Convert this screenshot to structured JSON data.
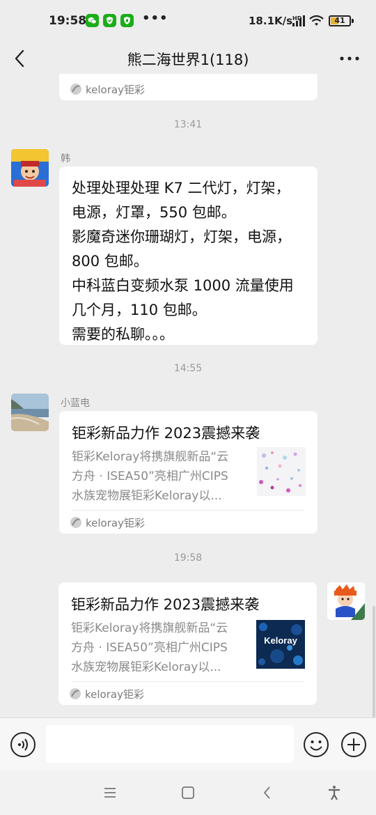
{
  "status_bar": {
    "time": "19:58",
    "more": "•••",
    "speed": "18.1K/s",
    "hd_badge": "HD",
    "battery_level": "41",
    "app_icons": [
      "wechat-icon",
      "shield-icon",
      "shield-icon"
    ]
  },
  "header": {
    "title": "熊二海世界1(118)"
  },
  "top_card": {
    "source": "keloray钜彩"
  },
  "messages": [
    {
      "time": "13:41",
      "sender": "韩",
      "lines": [
        "处理处理处理 K7 二代灯，灯架，",
        "电源，灯罩，550 包邮。",
        "影魔奇迷你珊瑚灯，灯架，电源，",
        "800 包邮。",
        "中科蓝白变频水泵 1000 流量使用",
        "几个月，110 包邮。",
        "需要的私聊。。。"
      ]
    },
    {
      "time": "14:55",
      "sender": "小蓝电",
      "card": {
        "title": "钜彩新品力作 2023震撼来袭",
        "desc": [
          "钜彩Keloray将携旗舰新品“云",
          "方舟 · ISEA50”亮相广州CIPS",
          "水族宠物展钜彩Keloray以..."
        ],
        "source": "keloray钜彩"
      }
    },
    {
      "time": "19:58",
      "sender": "",
      "card": {
        "title": "钜彩新品力作 2023震撼来袭",
        "desc": [
          "钜彩Keloray将携旗舰新品“云",
          "方舟 · ISEA50”亮相广州CIPS",
          "水族宠物展钜彩Keloray以..."
        ],
        "thumb_text": "Keloray",
        "source": "keloray钜彩"
      }
    }
  ],
  "input": {
    "placeholder": ""
  },
  "colors": {
    "background": "#ededed",
    "bubble": "#ffffff",
    "battery": "#e8b230",
    "wechat_green": "#1aad19"
  },
  "icons": {
    "back": "chevron-left-icon",
    "more": "more-icon",
    "voice": "voice-icon",
    "emoji": "emoji-icon",
    "plus": "plus-icon",
    "nav_menu": "menu-icon",
    "nav_home": "home-icon",
    "nav_back": "back-icon",
    "nav_accessibility": "accessibility-icon"
  }
}
